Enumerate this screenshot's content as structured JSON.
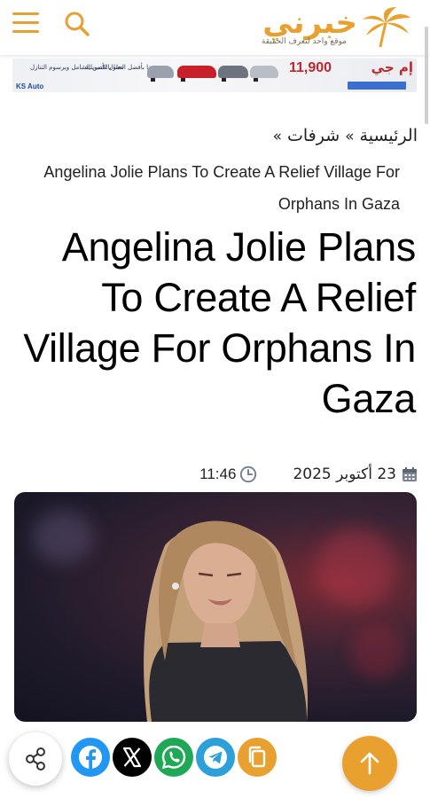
{
  "header": {
    "logo_text": "خبرني",
    "logo_tagline": "موقع واحد لتعرف الحقيقة",
    "menu_icon": "hamburger-menu-icon",
    "search_icon": "search-icon",
    "accent_color": "#e8a12e"
  },
  "ad_banner": {
    "logo": "KS Auto",
    "line1": "معنا بالتأمين الشامل وبرسوم التنازل",
    "line2": "معنا بأفضل الحلول التمويلية",
    "price": "11,900",
    "brand": "إم جي"
  },
  "breadcrumb": {
    "home": "الرئيسية",
    "section": "شرفات",
    "separator": "»",
    "current": "Angelina Jolie Plans To Create A Relief Village For Orphans In Gaza"
  },
  "article": {
    "title": "Angelina Jolie Plans To Create A Relief Village For Orphans In Gaza",
    "date": "23 أكتوبر 2025",
    "time": "11:46",
    "calendar_icon": "calendar-icon",
    "clock_icon": "clock-icon"
  },
  "share_bar": {
    "share_icon": "share-icon",
    "buttons": [
      {
        "name": "facebook",
        "color": "#2196f3"
      },
      {
        "name": "x",
        "color": "#000000"
      },
      {
        "name": "whatsapp",
        "color": "#1fa855"
      },
      {
        "name": "telegram",
        "color": "#2ea0d9"
      },
      {
        "name": "copy-link",
        "color": "#e8a12e"
      }
    ],
    "scroll_top_icon": "arrow-up-icon"
  }
}
